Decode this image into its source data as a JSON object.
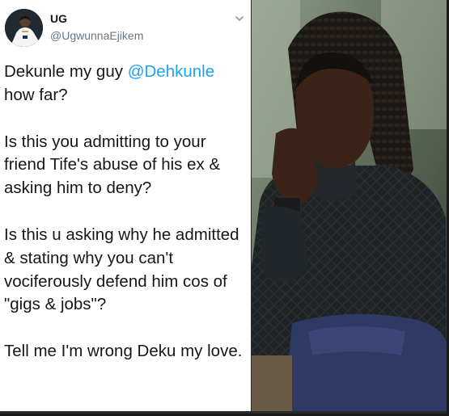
{
  "tweet": {
    "author": {
      "display_name": "UG",
      "handle": "@UgwunnaEjikem"
    },
    "paragraphs": [
      {
        "before": "Dekunle my guy ",
        "mention": "@Dehkunle",
        "after": " how far?"
      },
      {
        "text": "Is this you admitting to your friend Tife's abuse of his ex & asking him to deny?"
      },
      {
        "text": "Is this u asking why he admitted & stating why you can't vociferously defend him cos of \"gigs & jobs\"?"
      },
      {
        "text": "Tell me I'm wrong Deku my love."
      }
    ]
  },
  "colors": {
    "mention": "#1da1f2",
    "handle": "#657786",
    "text": "#14171a"
  },
  "icons": {
    "menu": "chevron-down-icon"
  }
}
